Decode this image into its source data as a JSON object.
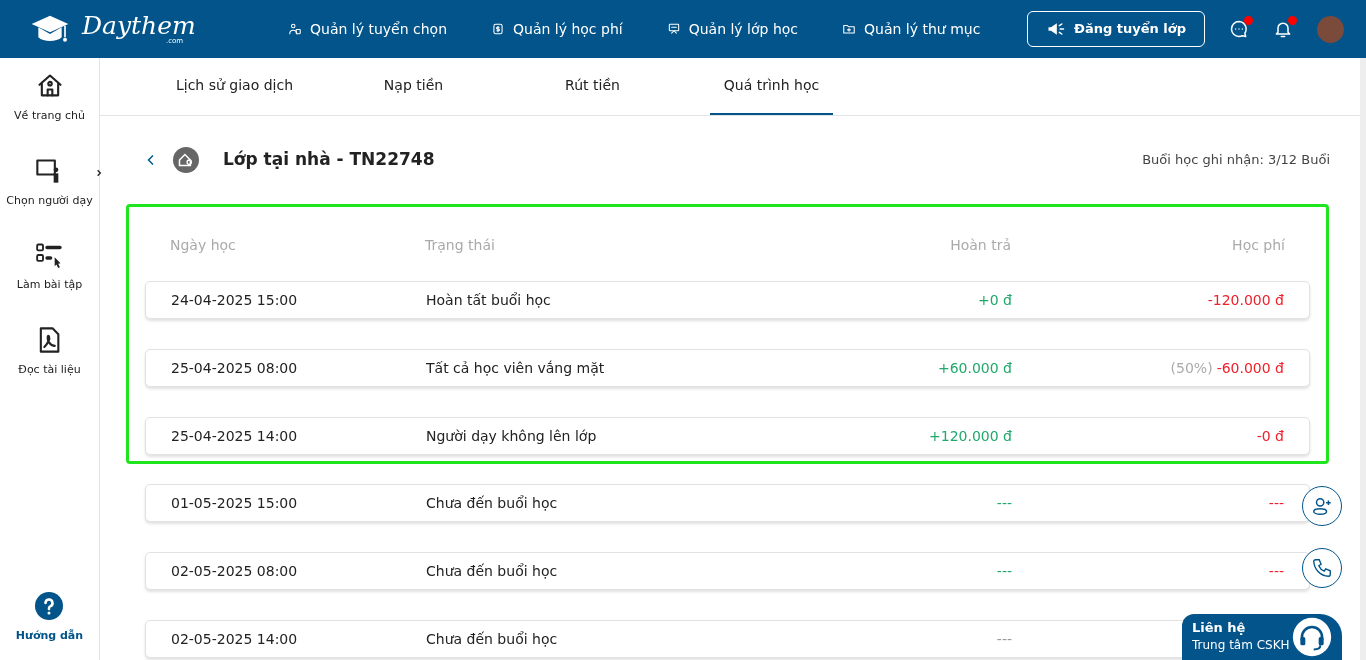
{
  "navbar": {
    "logo": {
      "name": "Daythem",
      "suffix": ".com"
    },
    "menu": [
      {
        "label": "Quản lý tuyển chọn",
        "kind": "people"
      },
      {
        "label": "Quản lý học phí",
        "kind": "fee"
      },
      {
        "label": "Quản lý lớp học",
        "kind": "class"
      },
      {
        "label": "Quản lý thư mục",
        "kind": "folder"
      }
    ],
    "post_button": "Đăng tuyển lớp",
    "chat_unread": true,
    "notification_unread": true
  },
  "sidebar": {
    "items": [
      {
        "label": "Về trang chủ",
        "kind": "home",
        "has_submenu": false
      },
      {
        "label": "Chọn người dạy",
        "kind": "teacher",
        "has_submenu": true
      },
      {
        "label": "Làm bài tập",
        "kind": "exercise",
        "has_submenu": false
      },
      {
        "label": "Đọc tài liệu",
        "kind": "pdf",
        "has_submenu": false
      }
    ],
    "help": "Hướng dẫn"
  },
  "tabs": [
    {
      "label": "Lịch sử giao dịch",
      "selected": false
    },
    {
      "label": "Nạp tiền",
      "selected": false
    },
    {
      "label": "Rút tiền",
      "selected": false
    },
    {
      "label": "Quá trình học",
      "selected": true
    }
  ],
  "class_header": {
    "title": "Lớp tại nhà - TN22748",
    "sessions_recorded": "Buổi học ghi nhận: 3/12 Buổi"
  },
  "table": {
    "columns": [
      "Ngày học",
      "Trạng thái",
      "Hoàn trả",
      "Học phí"
    ],
    "rows": [
      {
        "date": "24-04-2025 15:00",
        "status": "Hoàn tất buổi học",
        "refund": "+0 đ",
        "color": "#20a86b",
        "fee": "-120.000 đ",
        "highlighted": true
      },
      {
        "date": "25-04-2025 08:00",
        "status": "Tất cả học viên vắng mặt",
        "refund": "+60.000 đ",
        "color": "#20a86b",
        "fee_note": "(50%)",
        "fee": "-60.000 đ",
        "highlighted": true
      },
      {
        "date": "25-04-2025 14:00",
        "status": "Người dạy không lên lớp",
        "refund": "+120.000 đ",
        "color": "#20a86b",
        "fee": "-0 đ",
        "highlighted": true
      },
      {
        "date": "01-05-2025 15:00",
        "status": "Chưa đến buổi học",
        "refund": "---",
        "color": "#20a86b",
        "fee": "---",
        "highlighted": false
      },
      {
        "date": "02-05-2025 08:00",
        "status": "Chưa đến buổi học",
        "refund": "---",
        "color": "#20a86b",
        "fee": "---",
        "highlighted": false
      },
      {
        "date": "02-05-2025 14:00",
        "status": "Chưa đến buổi học",
        "refund": "---",
        "color": "#999999",
        "highlighted": false
      }
    ]
  },
  "contact": {
    "title": "Liên hệ",
    "subtitle": "Trung tâm CSKH"
  }
}
